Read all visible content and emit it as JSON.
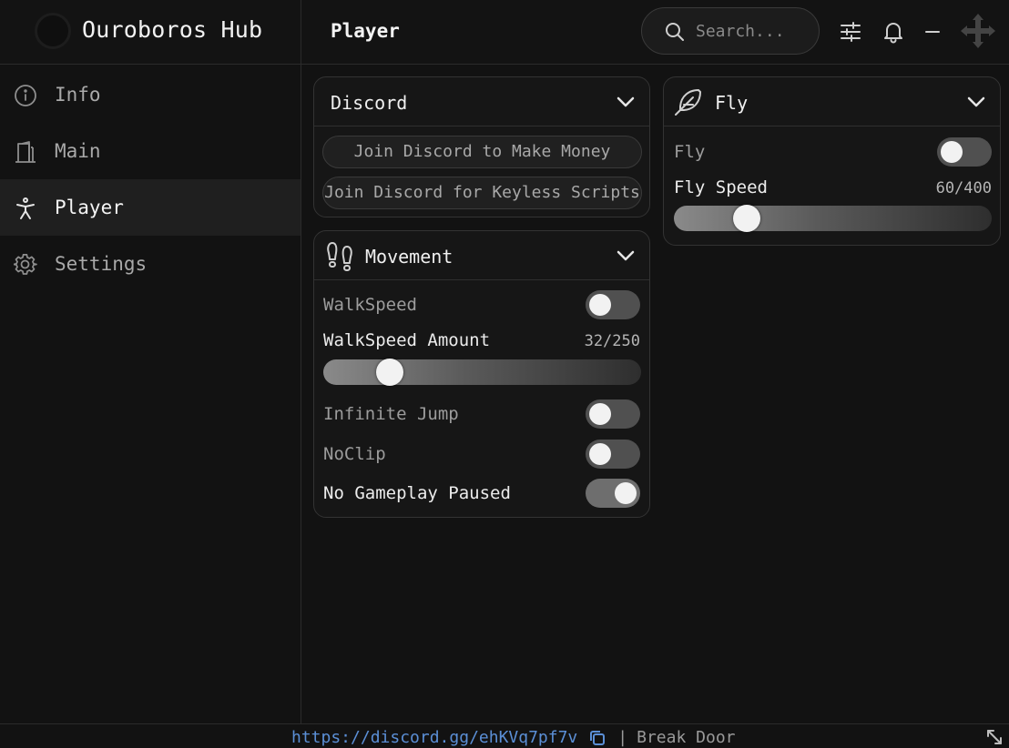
{
  "app": {
    "title": "Ouroboros Hub"
  },
  "header": {
    "page_title": "Player",
    "search_placeholder": "Search..."
  },
  "sidebar": {
    "items": [
      {
        "label": "Info",
        "icon": "info-icon",
        "active": false
      },
      {
        "label": "Main",
        "icon": "door-icon",
        "active": false
      },
      {
        "label": "Player",
        "icon": "person-icon",
        "active": true
      },
      {
        "label": "Settings",
        "icon": "gear-icon",
        "active": false
      }
    ]
  },
  "discord_card": {
    "title": "Discord",
    "buttons": [
      "Join Discord to Make Money",
      "Join Discord for Keyless Scripts"
    ]
  },
  "movement_card": {
    "title": "Movement",
    "icon": "footprints-icon",
    "walkspeed_label": "WalkSpeed",
    "walkspeed_on": false,
    "walkspeed_amount_label": "WalkSpeed Amount",
    "walkspeed_amount_value": "32/250",
    "walkspeed_amount": 32,
    "walkspeed_max": 250,
    "infinite_jump_label": "Infinite Jump",
    "infinite_jump_on": false,
    "noclip_label": "NoClip",
    "noclip_on": false,
    "no_gameplay_paused_label": "No Gameplay Paused",
    "no_gameplay_paused_on": true
  },
  "fly_card": {
    "title": "Fly",
    "icon": "feather-icon",
    "fly_label": "Fly",
    "fly_on": false,
    "fly_speed_label": "Fly Speed",
    "fly_speed_value": "60/400",
    "fly_speed": 60,
    "fly_speed_max": 400
  },
  "footer": {
    "link": "https://discord.gg/ehKVq7pf7v",
    "separator": "|",
    "text": "Break Door"
  }
}
